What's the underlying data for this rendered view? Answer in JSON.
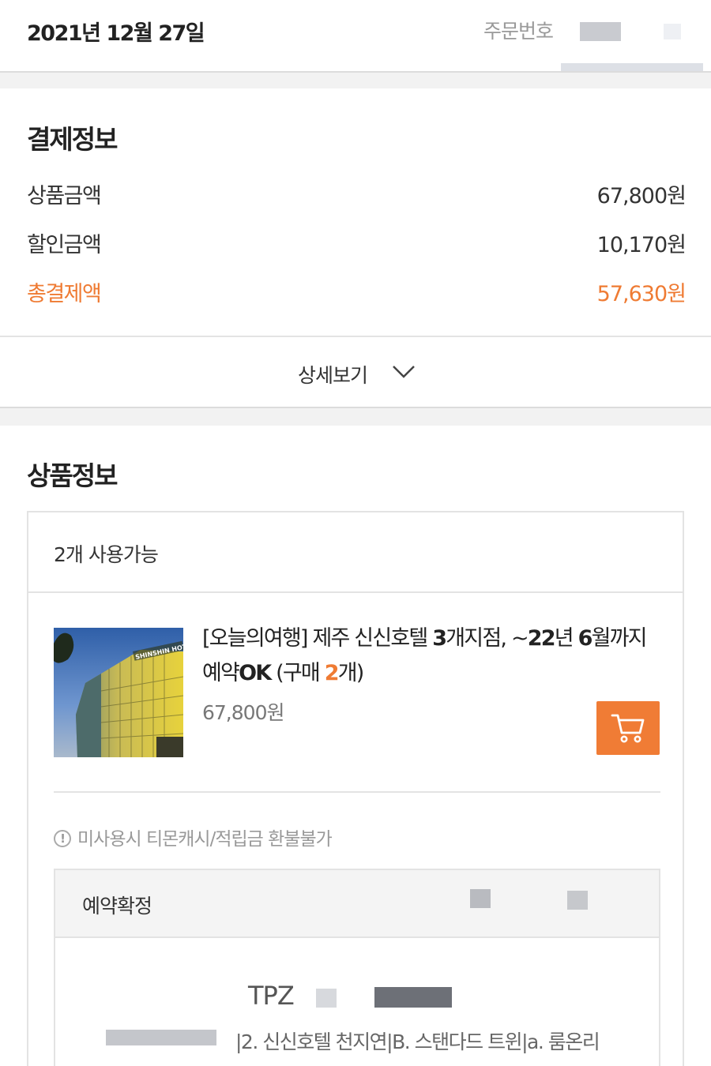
{
  "header": {
    "order_date": "2021년 12월 27일",
    "order_number_label": "주문번호"
  },
  "payment": {
    "title": "결제정보",
    "rows": [
      {
        "label": "상품금액",
        "value": "67,800원"
      },
      {
        "label": "할인금액",
        "value": "10,170원"
      },
      {
        "label": "총결제액",
        "value": "57,630원"
      }
    ],
    "detail_button": "상세보기",
    "accent_color": "#ef7b33"
  },
  "product": {
    "title": "상품정보",
    "usable_count": "2개 사용가능",
    "name_prefix": "[오늘의여행] 제주 신신호텔 ",
    "name_mid1": "3",
    "name_mid2": "개지점, ~",
    "name_mid3": "22",
    "name_mid4": "년 ",
    "name_mid5": "6",
    "name_mid6": "월까지 예약",
    "name_ok": "OK",
    "name_purchase": " (구매 ",
    "purchase_qty": "2",
    "name_suffix": "개)",
    "price": "67,800원",
    "cart_icon": "cart-icon",
    "thumbnail_sign": "SHINSHIN HOTEL",
    "notice": "미사용시 티몬캐시/적립금 환불불가",
    "reservation": {
      "status": "예약확정",
      "code_prefix": "TPZ",
      "room_info": "|2. 신신호텔 천지연|B. 스탠다드 트윈|a. 룸온리"
    }
  }
}
